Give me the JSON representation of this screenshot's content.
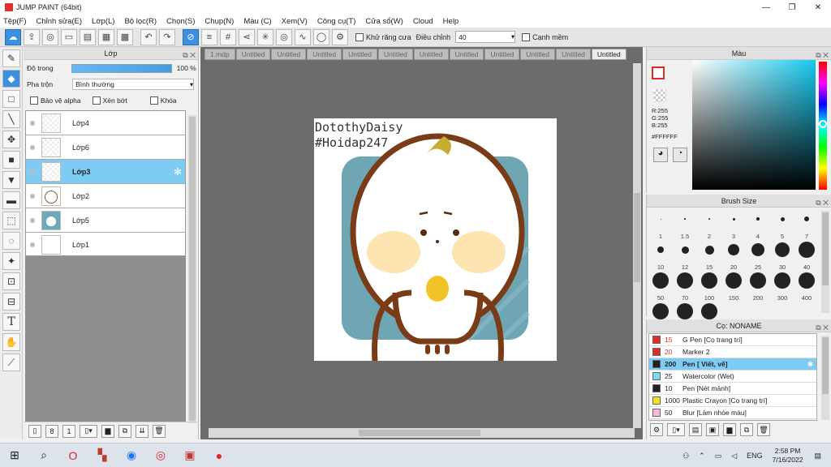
{
  "window": {
    "title": "JUMP PAINT (64bit)",
    "min": "—",
    "max": "❐",
    "close": "✕"
  },
  "menu": [
    "Tệp(F)",
    "Chỉnh sửa(E)",
    "Lớp(L)",
    "Bộ lọc(R)",
    "Chọn(S)",
    "Chụp(N)",
    "Màu (C)",
    "Xem(V)",
    "Công cụ(T)",
    "Cửa sổ(W)",
    "Cloud",
    "Help"
  ],
  "toolbar": {
    "antialias_label": "Khử răng cưa",
    "adjust_label": "Điều chỉnh",
    "adjust_value": "40",
    "edge_label": "Cạnh mềm"
  },
  "layer_panel": {
    "title": "Lớp",
    "opacity_label": "Độ trong",
    "opacity_value": "100 %",
    "opacity_fraction": 1.0,
    "blend_label": "Pha trộn",
    "blend_value": "Bình thường",
    "protect_alpha": "Bảo vệ alpha",
    "clip": "Xén bớt",
    "lock": "Khóa",
    "layers": [
      {
        "name": "Lớp4",
        "selected": false
      },
      {
        "name": "Lớp6",
        "selected": false
      },
      {
        "name": "Lớp3",
        "selected": true
      },
      {
        "name": "Lớp2",
        "selected": false
      },
      {
        "name": "Lớp5",
        "selected": false
      },
      {
        "name": "Lớp1",
        "selected": false
      }
    ]
  },
  "tabs": [
    "1.mdp",
    "Untitled",
    "Untitled",
    "Untitled",
    "Untitled",
    "Untitled",
    "Untitled",
    "Untitled",
    "Untitled",
    "Untitled",
    "Untitled",
    "Untitled"
  ],
  "active_tab_index": 11,
  "canvas": {
    "line1": "DotothyDaisy",
    "line2": "#Hoidap247"
  },
  "color_panel": {
    "title": "Màu",
    "r": "R:255",
    "g": "G:255",
    "b": "B:255",
    "hex": "#FFFFFF"
  },
  "brush_size": {
    "title": "Brush Size",
    "sizes": [
      "1",
      "1.5",
      "2",
      "3",
      "4",
      "5",
      "7",
      "10",
      "12",
      "15",
      "20",
      "25",
      "30",
      "40",
      "50",
      "70",
      "100",
      "150",
      "200",
      "300",
      "400",
      "",
      "",
      ""
    ]
  },
  "brush_list": {
    "title": "Cọ: NONAME",
    "items": [
      {
        "size": "15",
        "name": "G Pen [Cọ trang trí]",
        "color": "#e02b2b",
        "selected": false
      },
      {
        "size": "20",
        "name": "Marker 2",
        "color": "#e02b2b",
        "selected": false
      },
      {
        "size": "200",
        "name": "Pen [ Viết, vẽ]",
        "color": "#222222",
        "selected": true
      },
      {
        "size": "25",
        "name": "Watercolor (Wet)",
        "color": "#7fd6f5",
        "selected": false
      },
      {
        "size": "10",
        "name": "Pen [Nét mảnh]",
        "color": "#222222",
        "selected": false
      },
      {
        "size": "1000",
        "name": "Plastic Crayon [Cọ trang trí]",
        "color": "#f2e21c",
        "selected": false
      },
      {
        "size": "50",
        "name": "Blur [Làm nhòe màu]",
        "color": "#f7b6e0",
        "selected": false
      }
    ]
  },
  "taskbar": {
    "lang": "ENG",
    "time": "2:58 PM",
    "date": "7/16/2022"
  }
}
